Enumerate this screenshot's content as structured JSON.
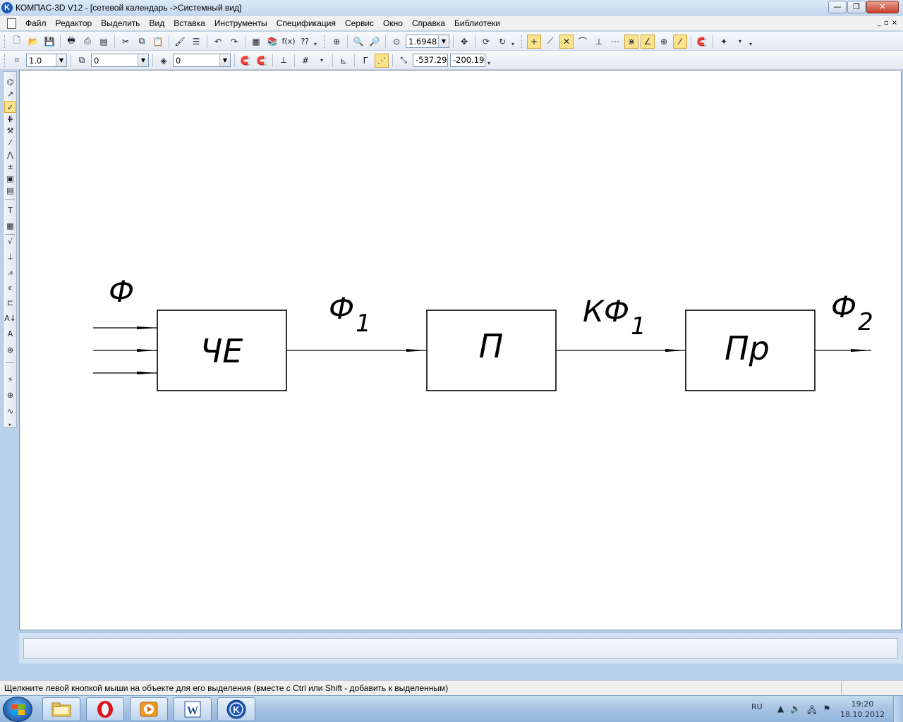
{
  "window": {
    "title": "КОМПАС-3D V12 - [сетевой календарь ->Системный вид]",
    "app_icon": "K",
    "buttons": {
      "minimize": "—",
      "maximize": "❐",
      "close": "✕"
    }
  },
  "menubar": {
    "items": [
      "Файл",
      "Редактор",
      "Выделить",
      "Вид",
      "Вставка",
      "Инструменты",
      "Спецификация",
      "Сервис",
      "Окно",
      "Справка",
      "Библиотеки"
    ],
    "doc_controls": {
      "minimize": "_",
      "restore": "▫",
      "close": "×"
    }
  },
  "toolbar1": {
    "zoom_value": "1.6948"
  },
  "toolbar2": {
    "step_value": "1.0",
    "angle_value": "0",
    "layer_value": "0",
    "coord_x": "-537.29",
    "coord_y": "-200.19"
  },
  "diagram": {
    "input_label_main": "Ф",
    "blocks": [
      {
        "label": "ЧЕ"
      },
      {
        "label": "П"
      },
      {
        "label": "Пр"
      }
    ],
    "arrow_labels": [
      {
        "main": "Ф",
        "sub": "1"
      },
      {
        "main": "КФ",
        "sub": "1"
      },
      {
        "main": "Ф",
        "sub": "2"
      }
    ]
  },
  "statusbar": {
    "hint": "Щелкните левой кнопкой мыши на объекте для его выделения (вместе с Ctrl или Shift - добавить к выделенным)"
  },
  "taskbar": {
    "apps": [
      "file-explorer-icon",
      "opera-icon",
      "media-player-icon",
      "word-icon",
      "kompas-icon"
    ],
    "word_label": "W",
    "kompas_label": "K",
    "language": "RU",
    "time": "19:20",
    "date": "18.10.2012"
  },
  "colors": {
    "accent_blue": "#1c58b5",
    "active_button": "#fbe38c",
    "canvas_bg": "#ffffff",
    "chrome_bg": "#b9d1ea"
  }
}
